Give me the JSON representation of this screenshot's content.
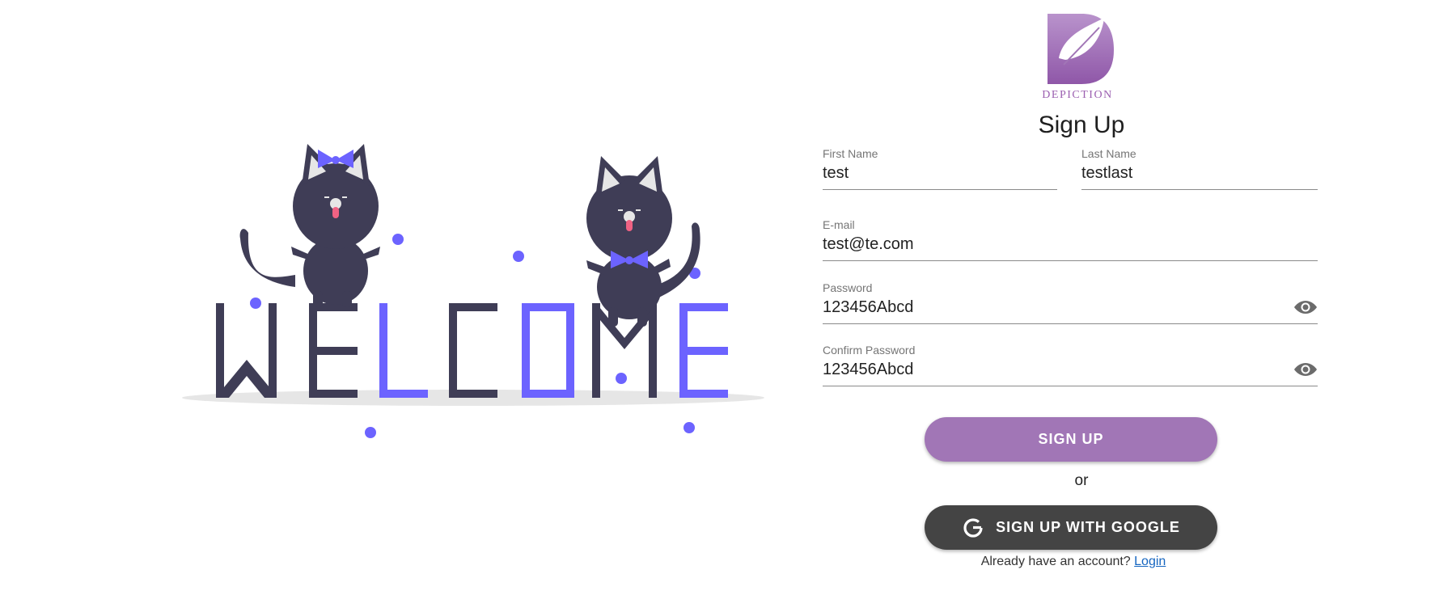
{
  "illustration": {
    "word": "WELCOME"
  },
  "brand": {
    "name": "DEPICTION"
  },
  "form": {
    "title": "Sign Up",
    "first_name": {
      "label": "First Name",
      "value": "test"
    },
    "last_name": {
      "label": "Last Name",
      "value": "testlast"
    },
    "email": {
      "label": "E-mail",
      "value": "test@te.com"
    },
    "password": {
      "label": "Password",
      "value": "123456Abcd",
      "toggle_icon": "eye-icon"
    },
    "confirm_password": {
      "label": "Confirm Password",
      "value": "123456Abcd",
      "toggle_icon": "eye-icon"
    },
    "signup_label": "SIGN UP",
    "or_text": "or",
    "google_label": "SIGN UP WITH GOOGLE",
    "have_account_text": "Already have an account?",
    "login_link": "Login"
  },
  "colors": {
    "primary_button": "#a176b6",
    "google_button": "#444444",
    "accent_purple": "#6c63ff",
    "dark_navy": "#3f3d56"
  }
}
